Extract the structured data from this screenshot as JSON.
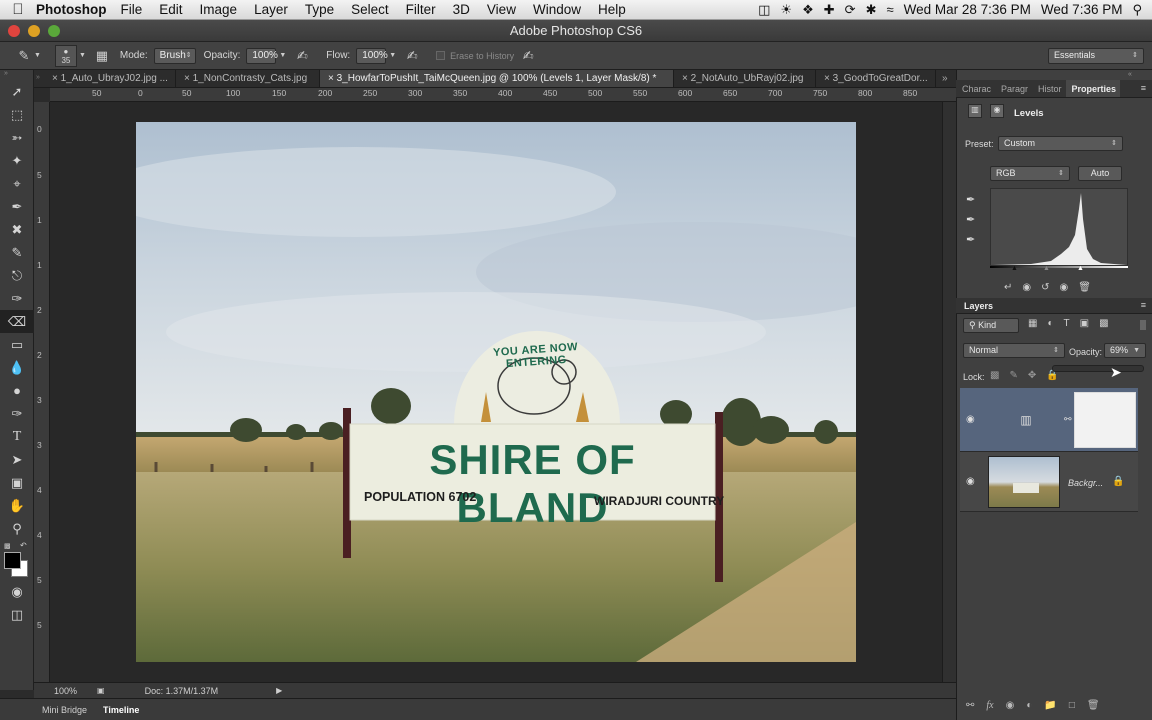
{
  "menubar": {
    "app_name": "Photoshop",
    "menus": [
      "File",
      "Edit",
      "Image",
      "Layer",
      "Type",
      "Select",
      "Filter",
      "3D",
      "View",
      "Window",
      "Help"
    ],
    "clock_date": "Wed Mar 28  7:36 PM",
    "clock_time": "Wed 7:36 PM"
  },
  "window": {
    "title": "Adobe Photoshop CS6"
  },
  "options": {
    "brush_size": "35",
    "mode_label": "Mode:",
    "mode_value": "Brush",
    "opacity_label": "Opacity:",
    "opacity_value": "100%",
    "flow_label": "Flow:",
    "flow_value": "100%",
    "erase_history_label": "Erase to History",
    "workspace": "Essentials"
  },
  "tabs": [
    {
      "label": "1_Auto_UbrayJ02.jpg ..."
    },
    {
      "label": "1_NonContrasty_Cats.jpg"
    },
    {
      "label": "3_HowfarToPushIt_TaiMcQueen.jpg @ 100% (Levels 1, Layer Mask/8) *"
    },
    {
      "label": "2_NotAuto_UbRayj02.jpg"
    },
    {
      "label": "3_GoodToGreatDor..."
    }
  ],
  "ruler": {
    "h_ticks": [
      "50",
      "0",
      "50",
      "100",
      "150",
      "200",
      "250",
      "300",
      "350",
      "400",
      "450",
      "500",
      "550",
      "600",
      "650",
      "700",
      "750",
      "800",
      "850"
    ],
    "v_ticks": [
      "0",
      "5",
      "1",
      "1",
      "2",
      "2",
      "3",
      "3",
      "4",
      "4",
      "5",
      "5"
    ]
  },
  "photo": {
    "sign_arc": "YOU ARE NOW ENTERING",
    "sign_title": "SHIRE OF BLAND",
    "sign_population": "POPULATION 6702",
    "sign_country": "WIRADJURI COUNTRY"
  },
  "status": {
    "zoom": "100%",
    "doc": "Doc: 1.37M/1.37M"
  },
  "bottom_tabs": [
    "Mini Bridge",
    "Timeline"
  ],
  "panels": {
    "tabs": [
      "Charac",
      "Paragr",
      "Histor",
      "Properties"
    ],
    "adjustment_title": "Levels",
    "preset_label": "Preset:",
    "preset_value": "Custom",
    "channel_value": "RGB",
    "auto_label": "Auto",
    "layers_title": "Layers",
    "kind_label": "Kind",
    "blend_mode": "Normal",
    "opacity_label": "Opacity:",
    "opacity_value": "69%",
    "lock_label": "Lock:",
    "layers": [
      {
        "name": "",
        "type": "adjustment"
      },
      {
        "name": "Backgr...",
        "type": "background"
      }
    ]
  },
  "colors": {
    "accent_green": "#1f6a4e",
    "panel_bg": "#404040",
    "selected_layer": "#56657d"
  }
}
